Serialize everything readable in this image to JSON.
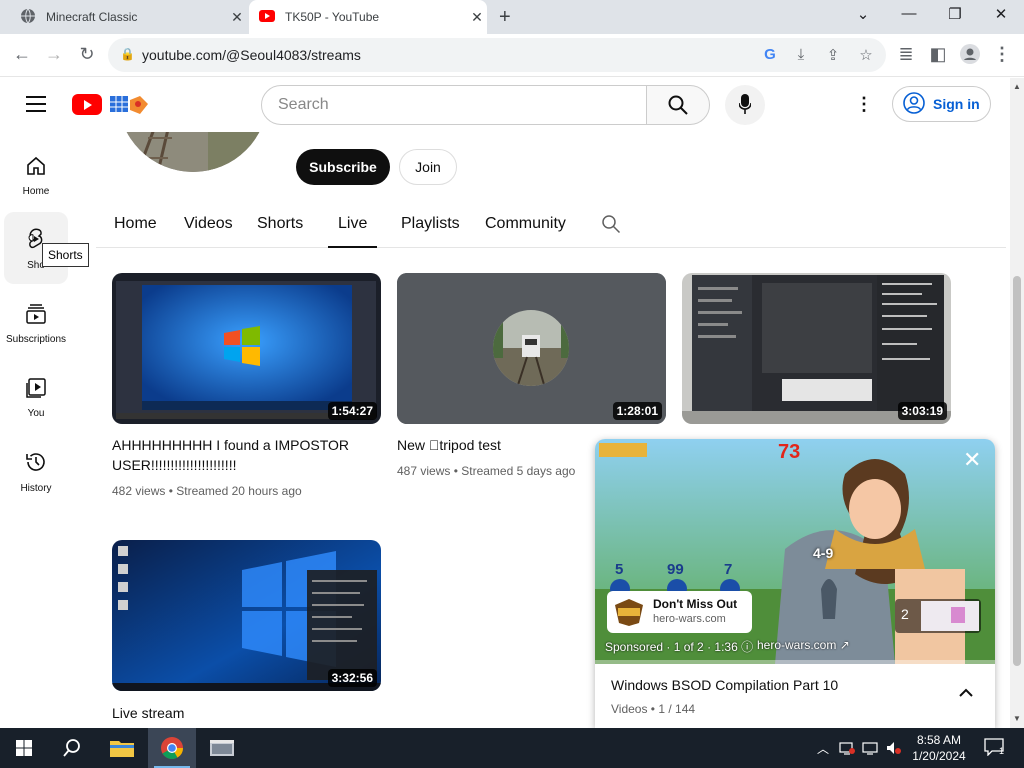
{
  "browser": {
    "tabs": [
      {
        "title": "Minecraft Classic",
        "active": false
      },
      {
        "title": "TK50P - YouTube",
        "active": true
      }
    ],
    "url": "youtube.com/@Seoul4083/streams"
  },
  "youtube": {
    "search_placeholder": "Search",
    "sign_in": "Sign in",
    "guide": [
      {
        "label": "Home",
        "icon": "home-icon"
      },
      {
        "label": "Shorts",
        "icon": "shorts-icon"
      },
      {
        "label": "Subscriptions",
        "icon": "subscriptions-icon"
      },
      {
        "label": "You",
        "icon": "you-icon"
      },
      {
        "label": "History",
        "icon": "history-icon"
      }
    ],
    "shorts_partial": "Sho",
    "tooltip": "Shorts",
    "channel": {
      "subscribe": "Subscribe",
      "join": "Join",
      "tabs": [
        "Home",
        "Videos",
        "Shorts",
        "Live",
        "Playlists",
        "Community"
      ],
      "active_tab": "Live"
    },
    "videos": [
      {
        "title_line1": "AHHHHHHHHH I found a IMPOSTOR",
        "title_line2": "USER!!!!!!!!!!!!!!!!!!!!!!",
        "duration": "1:54:27",
        "views": "482 views",
        "streamed": "Streamed 20 hours ago"
      },
      {
        "title_line1": "New \u0000tripod test",
        "title_line2": "",
        "duration": "1:28:01",
        "views": "487 views",
        "streamed": "Streamed 5 days ago"
      },
      {
        "title_line1": "",
        "title_line2": "",
        "duration": "3:03:19",
        "views": "",
        "streamed": ""
      },
      {
        "title_line1": "Live stream",
        "title_line2": "",
        "duration": "3:32:56",
        "views": "",
        "streamed": ""
      }
    ],
    "miniplayer": {
      "title": "Windows BSOD Compilation Part 10",
      "subtitle": "Videos • 1 / 144",
      "ad_title": "Don't Miss Out",
      "ad_url": "hero-wars.com",
      "sponsored": "Sponsored · 1 of 2 · 1:36",
      "ad_site": "hero-wars.com",
      "ad_count": "2",
      "game_numbers": [
        "73",
        "5",
        "99",
        "7",
        "4-9"
      ],
      "ad_progress": 0.0
    }
  },
  "taskbar": {
    "time": "8:58 AM",
    "date": "1/20/2024",
    "notification_count": "1"
  },
  "colors": {
    "youtube_red": "#ff0000",
    "link_blue": "#065fd4",
    "taskbar": "#18202a"
  }
}
